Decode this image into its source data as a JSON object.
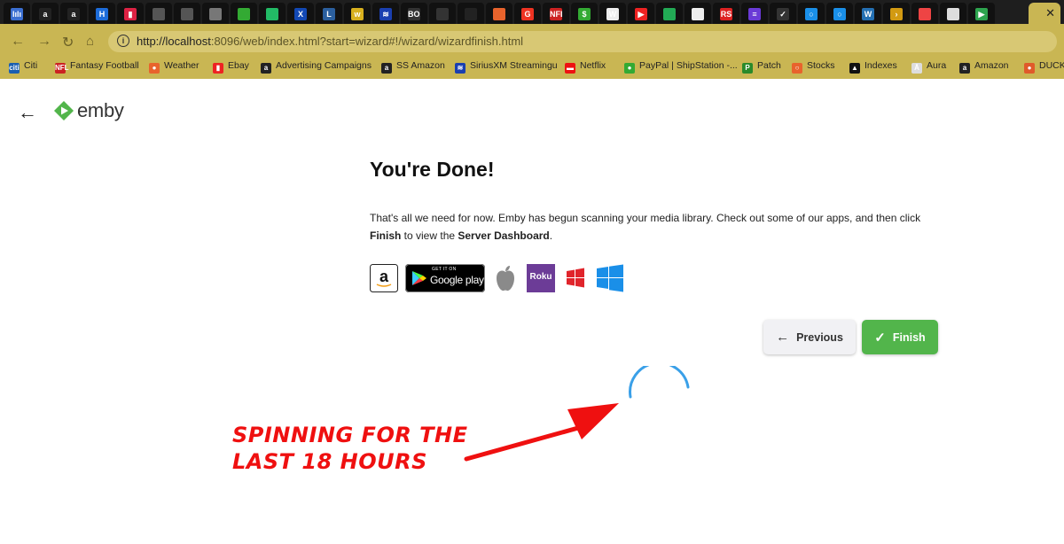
{
  "browser": {
    "url_main": "http://localhost",
    "url_rest": ":8096/web/index.html?start=wizard#!/wizard/wizardfinish.html",
    "tab_close": "✕",
    "tab_icons": [
      {
        "label": "lılı",
        "color": "#3b6fd1"
      },
      {
        "label": "a",
        "color": "#222"
      },
      {
        "label": "a",
        "color": "#222"
      },
      {
        "label": "H",
        "color": "#1d6cd9"
      },
      {
        "label": "▮",
        "color": "#d24"
      },
      {
        "label": "",
        "color": "#555"
      },
      {
        "label": "",
        "color": "#555"
      },
      {
        "label": "",
        "color": "#777"
      },
      {
        "label": "",
        "color": "#3a3"
      },
      {
        "label": "",
        "color": "#2b6"
      },
      {
        "label": "X",
        "color": "#1248b4"
      },
      {
        "label": "L",
        "color": "#2b5f9e"
      },
      {
        "label": "w",
        "color": "#d8b01e"
      },
      {
        "label": "≋",
        "color": "#1a3fb0"
      },
      {
        "label": "BOAT",
        "color": "#333"
      },
      {
        "label": "",
        "color": "#333"
      },
      {
        "label": "",
        "color": "#222"
      },
      {
        "label": "",
        "color": "#e8632c"
      },
      {
        "label": "G",
        "color": "#e32"
      },
      {
        "label": "NFL",
        "color": "#c22"
      },
      {
        "label": "$",
        "color": "#3a3"
      },
      {
        "label": "W",
        "color": "#eee"
      },
      {
        "label": "▶",
        "color": "#e22"
      },
      {
        "label": "",
        "color": "#2a5"
      },
      {
        "label": "",
        "color": "#eee"
      },
      {
        "label": "RS",
        "color": "#d22"
      },
      {
        "label": "≡",
        "color": "#6a3ad6"
      },
      {
        "label": "✓",
        "color": "#333"
      },
      {
        "label": "○",
        "color": "#1a8fe8"
      },
      {
        "label": "○",
        "color": "#1a8fe8"
      },
      {
        "label": "W",
        "color": "#2470b3"
      },
      {
        "label": "›",
        "color": "#d29a12"
      },
      {
        "label": "",
        "color": "#e44"
      },
      {
        "label": "",
        "color": "#ddd"
      },
      {
        "label": "▶",
        "color": "#2da44e"
      }
    ],
    "bookmarks": [
      {
        "label": "Citi",
        "icon": "citi",
        "color": "#1b5fb0"
      },
      {
        "label": "Fantasy Football",
        "icon": "NFL",
        "color": "#c22"
      },
      {
        "label": "Weather",
        "icon": "●",
        "color": "#e8632c"
      },
      {
        "label": "Ebay",
        "icon": "▮",
        "color": "#e22"
      },
      {
        "label": "Advertising Campaigns",
        "icon": "a",
        "color": "#222"
      },
      {
        "label": "SS Amazon",
        "icon": "a",
        "color": "#222"
      },
      {
        "label": "SiriusXM Streamingu",
        "icon": "≋",
        "color": "#1a3fb0"
      },
      {
        "label": "Netflix",
        "icon": "▬",
        "color": "#e11"
      },
      {
        "label": "PayPal | ShipStation -...",
        "icon": "●",
        "color": "#3a3"
      },
      {
        "label": "Patch",
        "icon": "P",
        "color": "#2a8a2a"
      },
      {
        "label": "Stocks",
        "icon": "○",
        "color": "#e8632c"
      },
      {
        "label": "Indexes",
        "icon": "▲",
        "color": "#111"
      },
      {
        "label": "Aura",
        "icon": "Ā",
        "color": "#ddd"
      },
      {
        "label": "Amazon",
        "icon": "a",
        "color": "#222"
      },
      {
        "label": "DUCK",
        "icon": "●",
        "color": "#e05a2a"
      }
    ]
  },
  "page": {
    "logo_text": "emby",
    "title": "You're Done!",
    "desc_part1": "That's all we need for now. Emby has begun scanning your media library. Check out some of our apps, and then click ",
    "desc_finish": "Finish",
    "desc_part2": " to view the ",
    "desc_dashboard": "Server Dashboard",
    "desc_end": ".",
    "google_play_small": "GET IT ON",
    "google_play_big": "Google play",
    "amazon_small": "amazon",
    "roku_label": "Roku",
    "previous_label": "Previous",
    "finish_label": "Finish"
  },
  "annotation": {
    "line1": "SPINNING FOR THE",
    "line2": "LAST 18 HOURS"
  },
  "colors": {
    "accent_green": "#52b54b",
    "browser_theme": "#c9b653",
    "annotation_red": "#ef1010",
    "spinner_blue": "#3aa0e8"
  }
}
